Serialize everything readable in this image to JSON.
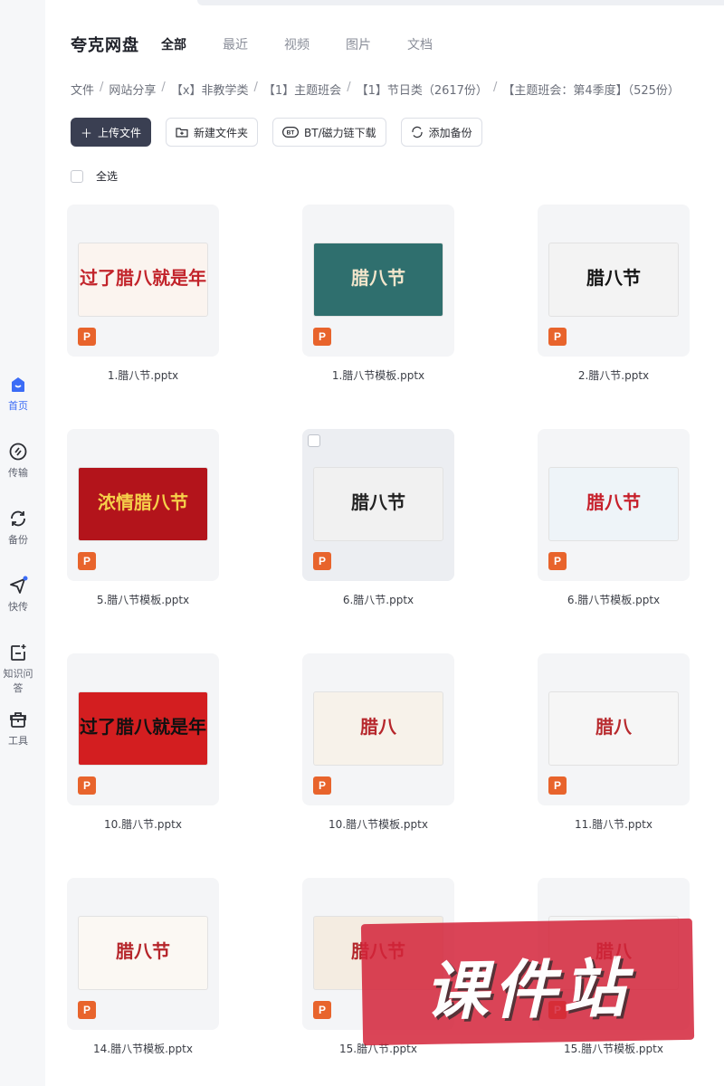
{
  "sidebar": {
    "items": [
      {
        "label": "首页",
        "icon": "home-icon",
        "active": true
      },
      {
        "label": "传输",
        "icon": "transfer-icon",
        "active": false
      },
      {
        "label": "备份",
        "icon": "backup-icon",
        "active": false
      },
      {
        "label": "快传",
        "icon": "quick-send-icon",
        "active": false
      },
      {
        "label": "知识问答",
        "icon": "qa-icon",
        "active": false
      },
      {
        "label": "工具",
        "icon": "toolbox-icon",
        "active": false
      }
    ]
  },
  "header": {
    "brand": "夸克网盘",
    "tabs": [
      "全部",
      "最近",
      "视频",
      "图片",
      "文档"
    ]
  },
  "breadcrumb": [
    "文件",
    "网站分享",
    "【x】非教学类",
    "【1】主题班会",
    "【1】节日类（2617份）",
    "【主题班会：第4季度】（525份）"
  ],
  "toolbar": {
    "upload": "上传文件",
    "new_folder": "新建文件夹",
    "bt_download": "BT/磁力链下载",
    "add_backup": "添加备份"
  },
  "select_all": "全选",
  "files": [
    {
      "name": "1.腊八节.pptx",
      "thumb_text": "过了腊八就是年",
      "bg": "#fbf4ef",
      "fg": "#c2242b"
    },
    {
      "name": "1.腊八节模板.pptx",
      "thumb_text": "腊八节",
      "bg": "#2f6f6e",
      "fg": "#f3e6cc"
    },
    {
      "name": "2.腊八节.pptx",
      "thumb_text": "腊八节",
      "bg": "#f3f3f3",
      "fg": "#141414"
    },
    {
      "name": "5.腊八节模板.pptx",
      "thumb_text": "浓情腊八节",
      "bg": "#b3141b",
      "fg": "#f6d04a"
    },
    {
      "name": "6.腊八节.pptx",
      "thumb_text": "腊八节",
      "bg": "#f1f1f1",
      "fg": "#222222"
    },
    {
      "name": "6.腊八节模板.pptx",
      "thumb_text": "腊八节",
      "bg": "#eef4f8",
      "fg": "#c61f2a"
    },
    {
      "name": "10.腊八节.pptx",
      "thumb_text": "过了腊八就是年",
      "bg": "#d31e20",
      "fg": "#111111"
    },
    {
      "name": "10.腊八节模板.pptx",
      "thumb_text": "腊八",
      "bg": "#f7f2ea",
      "fg": "#b6262b"
    },
    {
      "name": "11.腊八节.pptx",
      "thumb_text": "腊八",
      "bg": "#f6f6f6",
      "fg": "#b82a2e"
    },
    {
      "name": "14.腊八节模板.pptx",
      "thumb_text": "腊八节",
      "bg": "#fbf8f3",
      "fg": "#b5252a"
    },
    {
      "name": "15.腊八节.pptx",
      "thumb_text": "腊八节",
      "bg": "#f4ece1",
      "fg": "#b3252a"
    },
    {
      "name": "15.腊八节模板.pptx",
      "thumb_text": "腊八",
      "bg": "#f5f5f5",
      "fg": "#a52a2a"
    }
  ],
  "watermark": "课件站",
  "colors": {
    "accent": "#3b6cf6",
    "primary_button": "#3a3f52",
    "ppt_badge": "#e8642c"
  }
}
